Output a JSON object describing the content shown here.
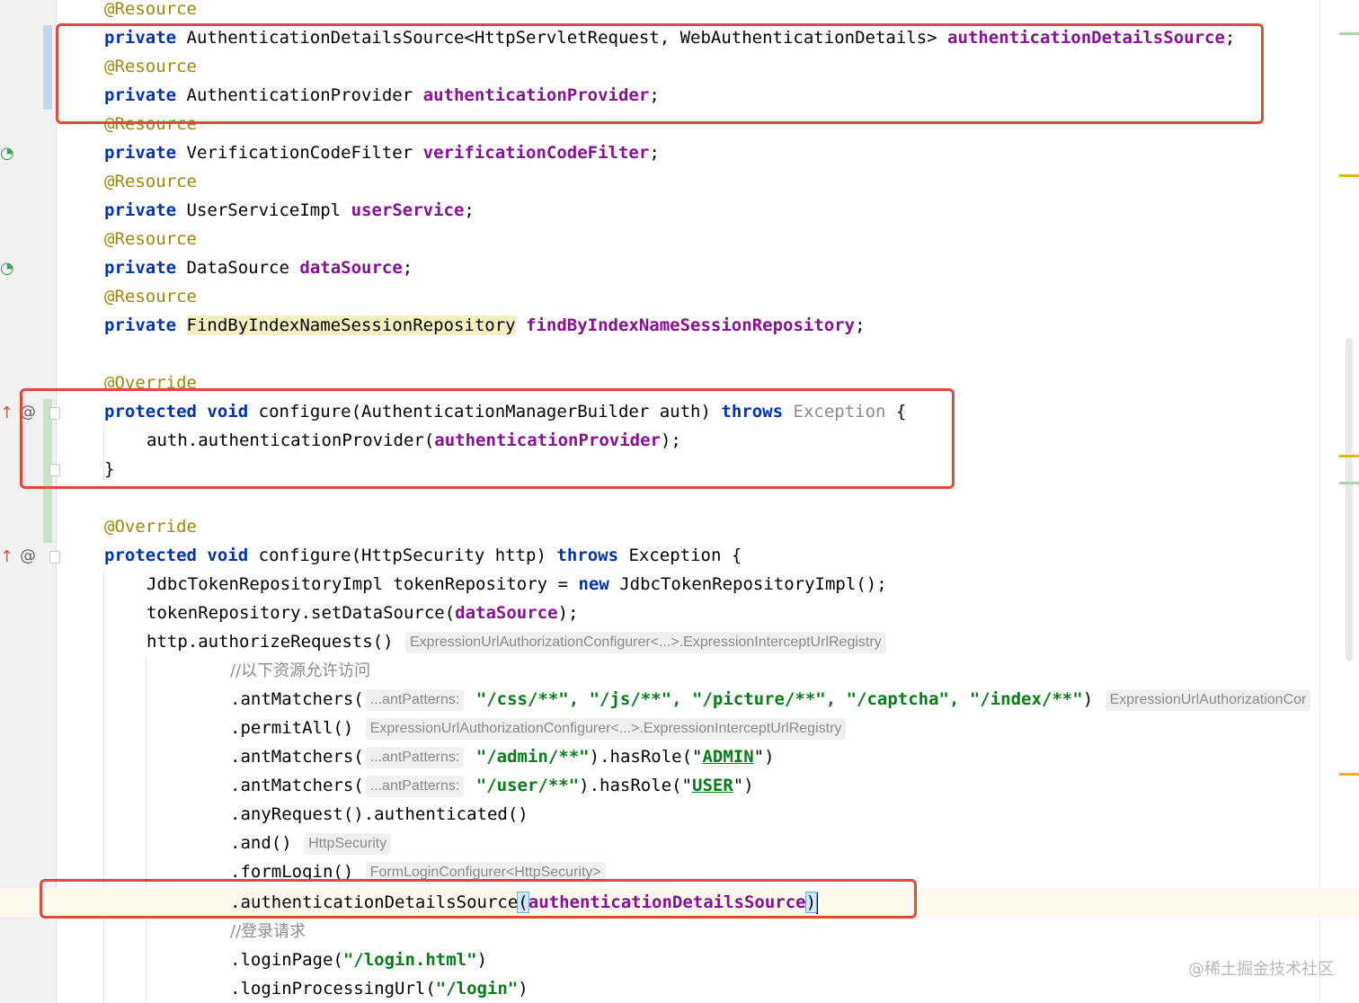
{
  "colors": {
    "keyword": "#0033b3",
    "annotation": "#9e880d",
    "field": "#871094",
    "string": "#067d17",
    "comment": "#8c8c8c",
    "highlight_box": "#e04a3a"
  },
  "code": {
    "ann_resource": "@Resource",
    "ann_override": "@Override",
    "kw_private": "private",
    "kw_protected": "protected",
    "kw_void": "void",
    "kw_throws": "throws",
    "kw_new": "new",
    "l2_type": "AuthenticationDetailsSource<HttpServletRequest, WebAuthenticationDetails>",
    "l2_field": "authenticationDetailsSource",
    "l4_type": "AuthenticationProvider",
    "l4_field": "authenticationProvider",
    "l6_type": "VerificationCodeFilter",
    "l6_field": "verificationCodeFilter",
    "l8_type": "UserServiceImpl",
    "l8_field": "userService",
    "l10_type": "DataSource",
    "l10_field": "dataSource",
    "l12_type": "FindByIndexNameSessionRepository",
    "l12_field": "findByIndexNameSessionRepository",
    "m1_sig": "configure(AuthenticationManagerBuilder auth)",
    "m1_exc": "Exception",
    "m1_body_pre": "auth.authenticationProvider(",
    "m1_body_arg": "authenticationProvider",
    "m1_body_post": ");",
    "close_brace": "}",
    "m2_sig": "configure(HttpSecurity http)",
    "m2_exc": "Exception {",
    "m2_l1_pre": "JdbcTokenRepositoryImpl tokenRepository = ",
    "m2_l1_post": "JdbcTokenRepositoryImpl();",
    "m2_l2_pre": "tokenRepository.setDataSource(",
    "m2_l2_arg": "dataSource",
    "m2_l2_post": ");",
    "m2_l3": "http.authorizeRequests()",
    "hint_registry": "ExpressionUrlAuthorizationConfigurer<...>.ExpressionInterceptUrlRegistry",
    "comment_permit": "//以下资源允许访问",
    "ant_matchers": ".antMatchers(",
    "hint_ant_patterns": "...antPatterns:",
    "ant1_args": "\"/css/**\", \"/js/**\", \"/picture/**\", \"/captcha\", \"/index/**\"",
    "hint_truncated": "ExpressionUrlAuthorizationCor",
    "permit_all": ".permitAll()",
    "ant2_path": "\"/admin/**\"",
    "has_role_open": ").hasRole(\"",
    "role_admin": "ADMIN",
    "role_close": "\")",
    "ant3_path": "\"/user/**\"",
    "role_user": "USER",
    "any_request": ".anyRequest().authenticated()",
    "and_call": ".and()",
    "hint_http_security": "HttpSecurity",
    "form_login": ".formLogin()",
    "hint_form_login": "FormLoginConfigurer<HttpSecurity>",
    "auth_details_call": ".authenticationDetailsSource",
    "open_paren": "(",
    "close_paren": ")",
    "comment_login": "//登录请求",
    "login_page_pre": ".loginPage(",
    "login_page_arg": "\"/login.html\"",
    "login_proc_pre": ".loginProcessingUrl(",
    "login_proc_arg": "\"/login\"",
    "semicolon": ";",
    "open_brace": "{"
  },
  "gutter": {
    "at_icon": "@"
  },
  "watermark": "@稀土掘金技术社区"
}
